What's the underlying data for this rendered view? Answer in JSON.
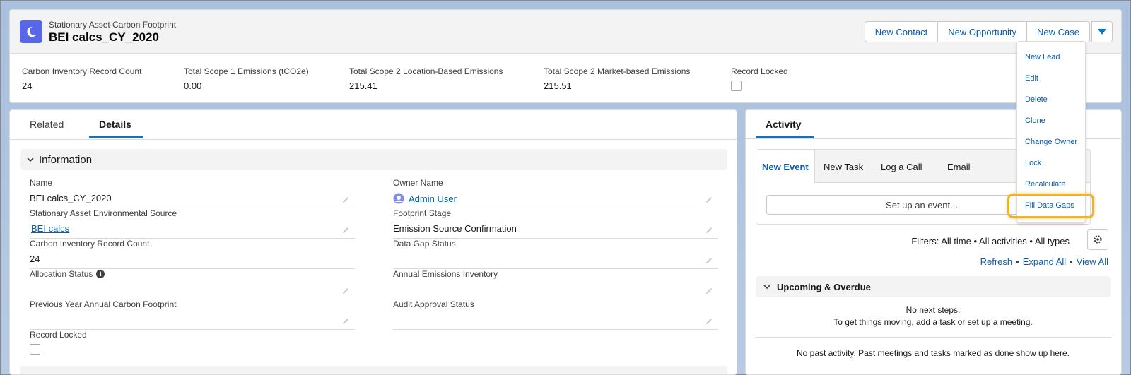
{
  "header": {
    "object_type": "Stationary Asset Carbon Footprint",
    "record_name": "BEI calcs_CY_2020",
    "buttons": [
      "New Contact",
      "New Opportunity",
      "New Case"
    ]
  },
  "highlights": [
    {
      "label": "Carbon Inventory Record Count",
      "value": "24"
    },
    {
      "label": "Total Scope 1 Emissions (tCO2e)",
      "value": "0.00"
    },
    {
      "label": "Total Scope 2 Location-Based Emissions",
      "value": "215.41"
    },
    {
      "label": "Total Scope 2 Market-based Emissions",
      "value": "215.51"
    },
    {
      "label": "Record Locked",
      "value": ""
    }
  ],
  "tabs": {
    "related": "Related",
    "details": "Details"
  },
  "section": {
    "title": "Information"
  },
  "fields": {
    "name": {
      "label": "Name",
      "value": "BEI calcs_CY_2020"
    },
    "owner": {
      "label": "Owner Name",
      "value": "Admin User"
    },
    "env_source": {
      "label": "Stationary Asset Environmental Source",
      "value": "BEI calcs"
    },
    "footprint_stage": {
      "label": "Footprint Stage",
      "value": "Emission Source Confirmation"
    },
    "record_count": {
      "label": "Carbon Inventory Record Count",
      "value": "24"
    },
    "data_gap": {
      "label": "Data Gap Status",
      "value": ""
    },
    "allocation": {
      "label": "Allocation Status",
      "value": ""
    },
    "annual_inventory": {
      "label": "Annual Emissions Inventory",
      "value": ""
    },
    "prev_year": {
      "label": "Previous Year Annual Carbon Footprint",
      "value": ""
    },
    "audit": {
      "label": "Audit Approval Status",
      "value": ""
    },
    "record_locked": {
      "label": "Record Locked"
    }
  },
  "activity": {
    "tab": "Activity",
    "composer_tabs": [
      "New Event",
      "New Task",
      "Log a Call",
      "Email"
    ],
    "event_placeholder": "Set up an event...",
    "filters": "Filters: All time • All activities • All types",
    "links": [
      "Refresh",
      "Expand All",
      "View All"
    ],
    "upcoming_title": "Upcoming & Overdue",
    "no_next_line1": "No next steps.",
    "no_next_line2": "To get things moving, add a task or set up a meeting.",
    "no_past": "No past activity. Past meetings and tasks marked as done show up here."
  },
  "menu": {
    "items": [
      "New Lead",
      "Edit",
      "Delete",
      "Clone",
      "Change Owner",
      "Lock",
      "Recalculate",
      "Fill Data Gaps"
    ]
  },
  "colors": {
    "brand": "#0176d3",
    "link": "#0b5cab",
    "icon_bg": "#5867e8",
    "highlight": "#f0b323"
  }
}
